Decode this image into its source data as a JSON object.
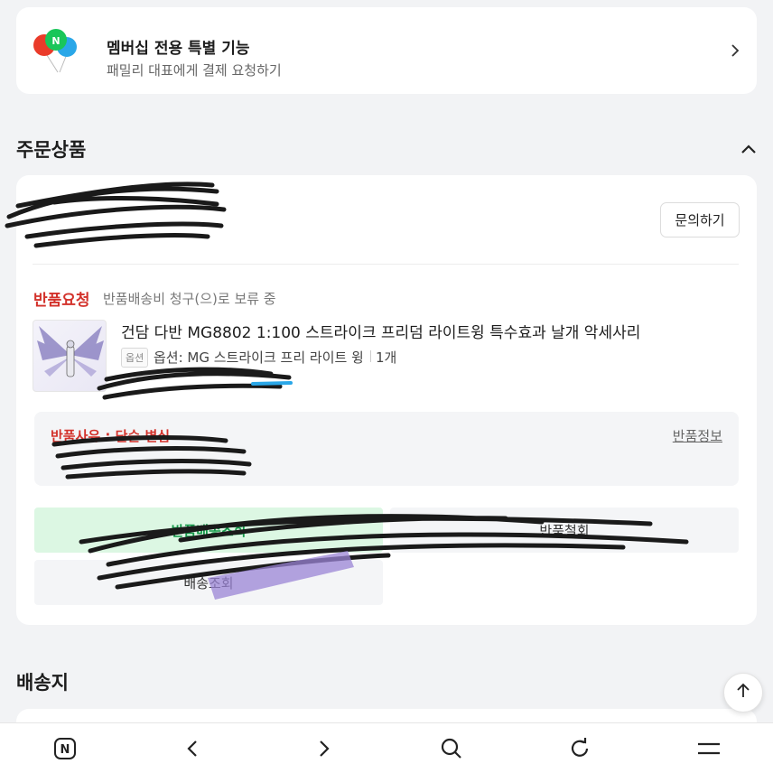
{
  "membership": {
    "title": "멤버십 전용 특별 기능",
    "subtitle": "패밀리 대표에게 결제 요청하기"
  },
  "order_section": {
    "title": "주문상품",
    "inquiry_label": "문의하기",
    "status": "반품요청",
    "status_detail": "반품배송비 청구(으)로 보류 중",
    "product_name": "건담 다반 MG8802 1:100 스트라이크 프리덤 라이트윙 특수효과 날개 악세사리",
    "option_badge": "옵션",
    "option_text": "옵션: MG 스트라이크 프리 라이트 윙",
    "quantity": "1개",
    "reason": "반품사유 : 단순 변심",
    "return_info_link": "반품정보",
    "actions": {
      "collect": "반품배송조회",
      "cancel": "반품철회",
      "track": "배송조회"
    }
  },
  "shipping_section": {
    "title": "배송지"
  },
  "colors": {
    "status_red": "#d3322b",
    "green_action_bg": "#dcf7e3",
    "green_action_text": "#159a4a",
    "redaction_ink": "#1a1a1a"
  },
  "icons": {
    "membership": "balloons-icon",
    "banner_chevron": "chevron-right-icon",
    "collapse": "chevron-up-icon",
    "scroll_top": "arrow-up-icon",
    "bottom_nav": [
      "naver-home-icon",
      "back-icon",
      "forward-icon",
      "search-icon",
      "refresh-icon",
      "menu-icon"
    ]
  }
}
